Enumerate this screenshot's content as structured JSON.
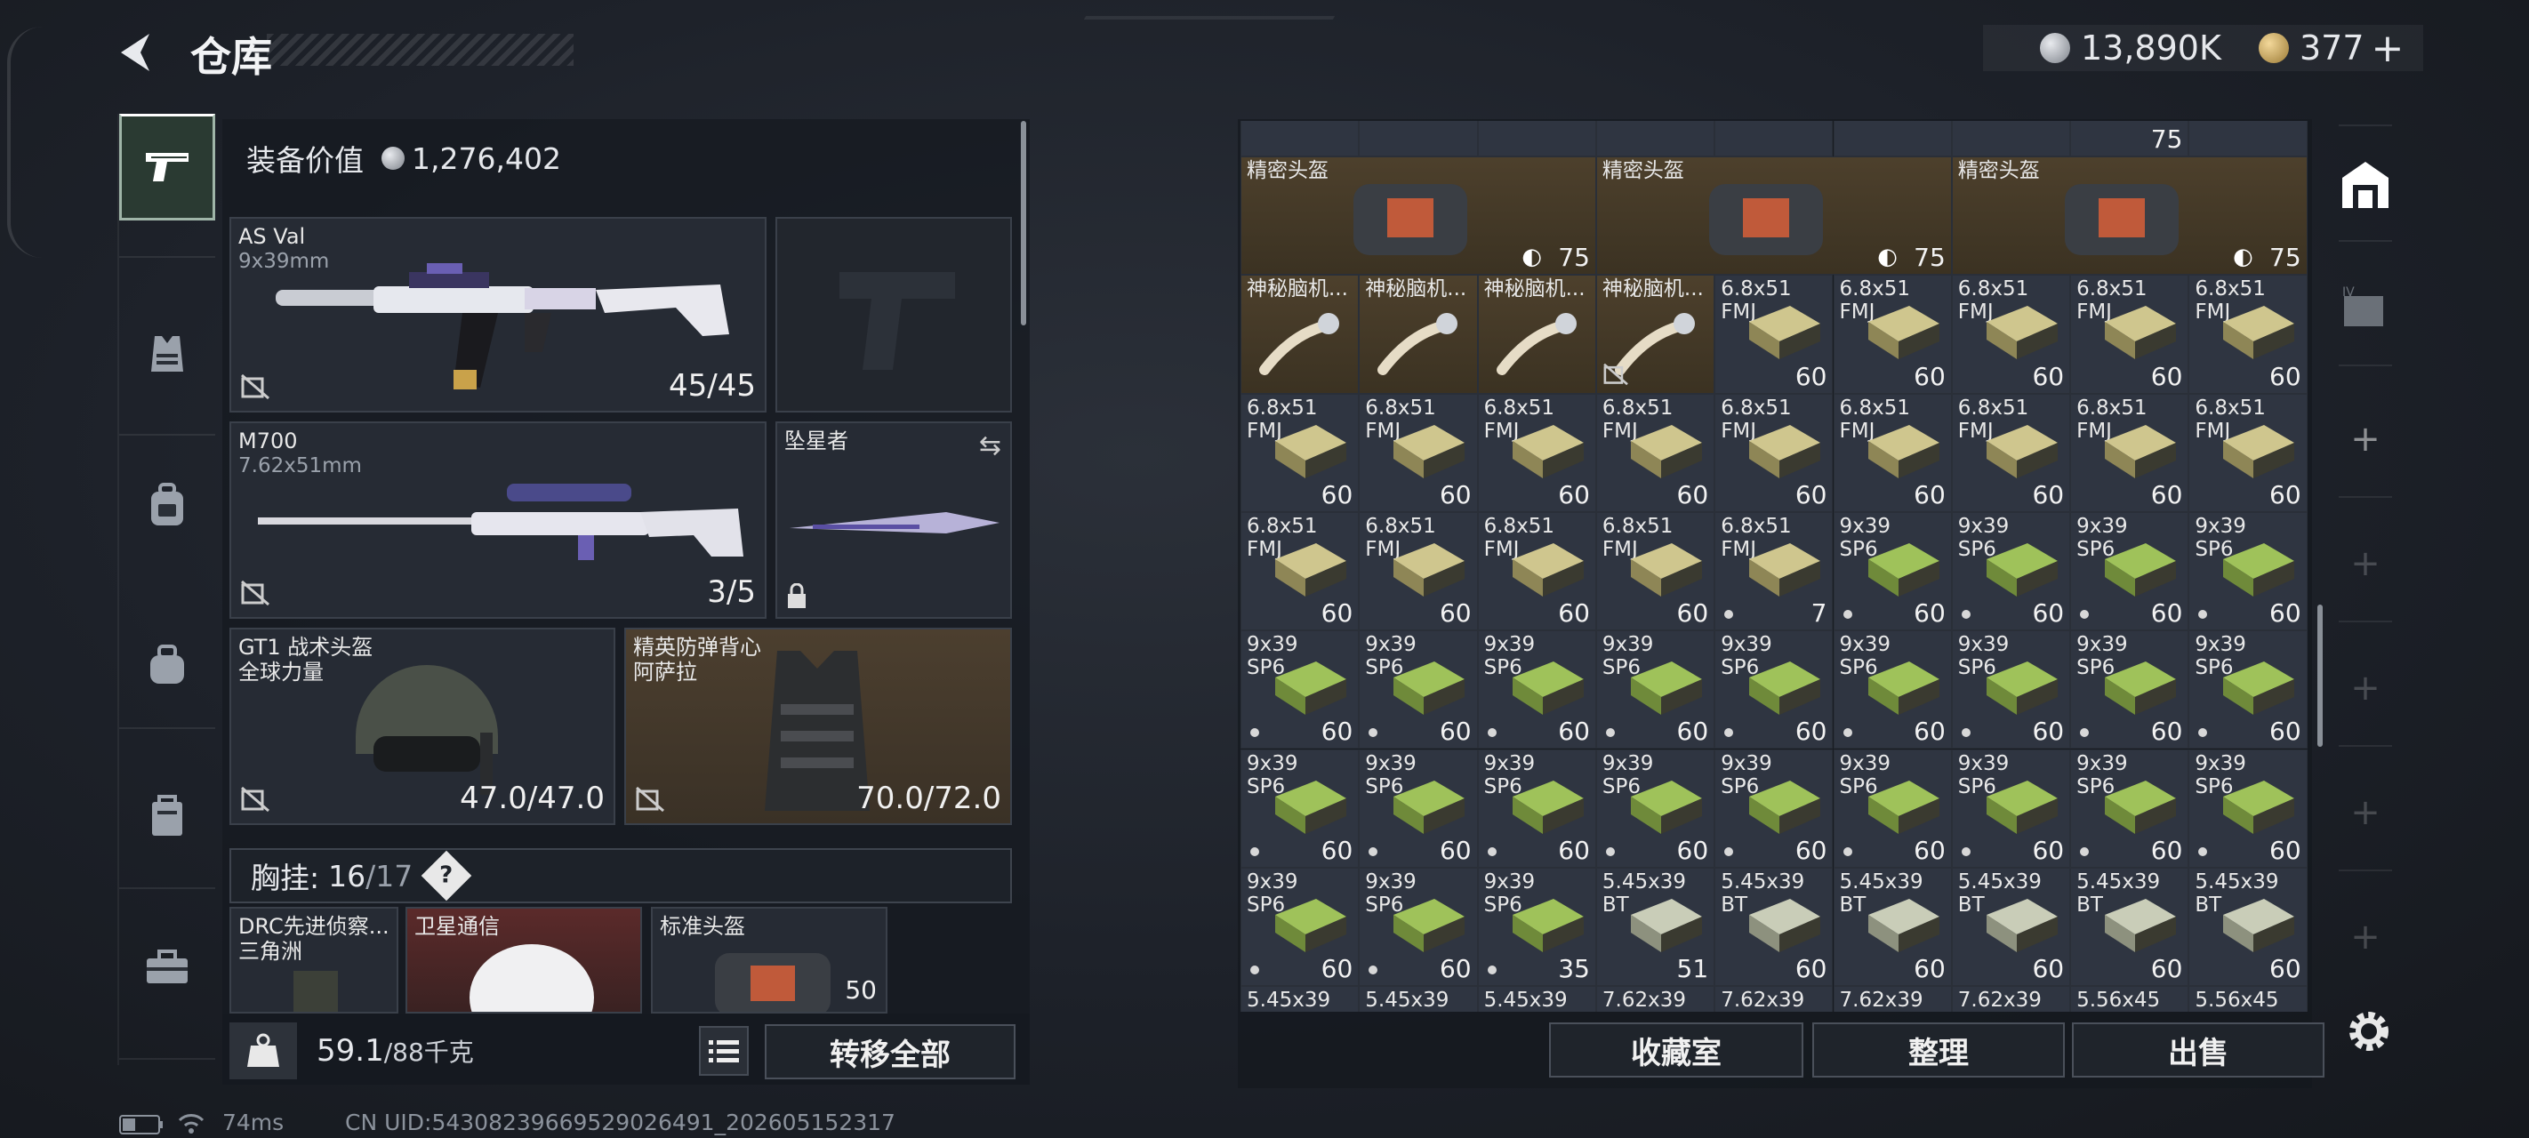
{
  "header": {
    "title": "仓库",
    "currency_silver": "13,890K",
    "currency_gold": "377"
  },
  "loadout": {
    "value_label": "装备价值",
    "value": "1,276,402",
    "primary": {
      "name": "AS Val",
      "caliber": "9x39mm",
      "ammo": "45/45"
    },
    "secondary": {
      "name": "M700",
      "caliber": "7.62x51mm",
      "ammo": "3/5"
    },
    "melee": {
      "name": "坠星者"
    },
    "helmet": {
      "name": "GT1 战术头盔",
      "sub": "全球力量",
      "durability": "47.0/47.0"
    },
    "armor": {
      "name": "精英防弹背心",
      "sub": "阿萨拉",
      "durability": "70.0/72.0"
    },
    "chest_rig": {
      "label": "胸挂:",
      "current": "16",
      "max": "17",
      "help": "?"
    },
    "rig_items": [
      {
        "name": "DRC先进侦察...",
        "sub": "三角洲"
      },
      {
        "name": "卫星通信"
      },
      {
        "name": "标准头盔",
        "count": "50"
      }
    ]
  },
  "footer_left": {
    "weight": "59.1",
    "weight_max": "/88千克",
    "transfer_all": "转移全部"
  },
  "status_bar": {
    "ping": "74ms",
    "uid": "CN UID:54308239669529026491_202605152317"
  },
  "storage": {
    "top_partial": {
      "count": "75"
    },
    "helmets": [
      {
        "name": "精密头盔",
        "count": "75"
      },
      {
        "name": "精密头盔",
        "count": "75"
      },
      {
        "name": "精密头盔",
        "count": "75"
      }
    ],
    "mystery": {
      "name": "神秘脑机..."
    },
    "ammo_names": {
      "a68": "6.8x51\nFMJ",
      "a939": "9x39\nSP6",
      "a545": "5.45x39\nBT"
    },
    "counts": {
      "c60": "60",
      "c7": "7",
      "c35": "35",
      "c51": "51"
    },
    "bottom_partial": [
      "5.45x39",
      "5.45x39",
      "5.45x39",
      "7.62x39",
      "7.62x39",
      "7.62x39",
      "7.62x39",
      "5.56x45",
      "5.56x45"
    ]
  },
  "buttons": {
    "collection": "收藏室",
    "sort": "整理",
    "sell": "出售"
  }
}
